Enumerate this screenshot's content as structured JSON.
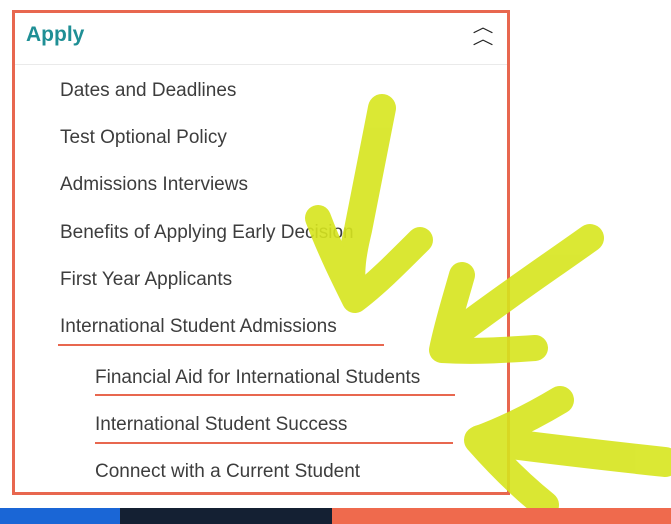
{
  "panel": {
    "title": "Apply",
    "collapse_icon": "double-chevron-up-icon"
  },
  "menu": {
    "items": [
      {
        "label": "Dates and Deadlines"
      },
      {
        "label": "Test Optional Policy"
      },
      {
        "label": "Admissions Interviews"
      },
      {
        "label": "Benefits of Applying Early Decision"
      },
      {
        "label": "First Year Applicants"
      },
      {
        "label": "International Student Admissions"
      }
    ],
    "subitems": [
      {
        "label": "Financial Aid for International Students"
      },
      {
        "label": "International Student Success"
      },
      {
        "label": "Connect with a Current Student"
      }
    ]
  },
  "colors": {
    "accent": "#e8674f",
    "title": "#1f8f95",
    "highlighter": "#d7e51e",
    "bar_blue": "#1a66d6",
    "bar_navy": "#142033",
    "bar_orange": "#ef6a4d"
  }
}
